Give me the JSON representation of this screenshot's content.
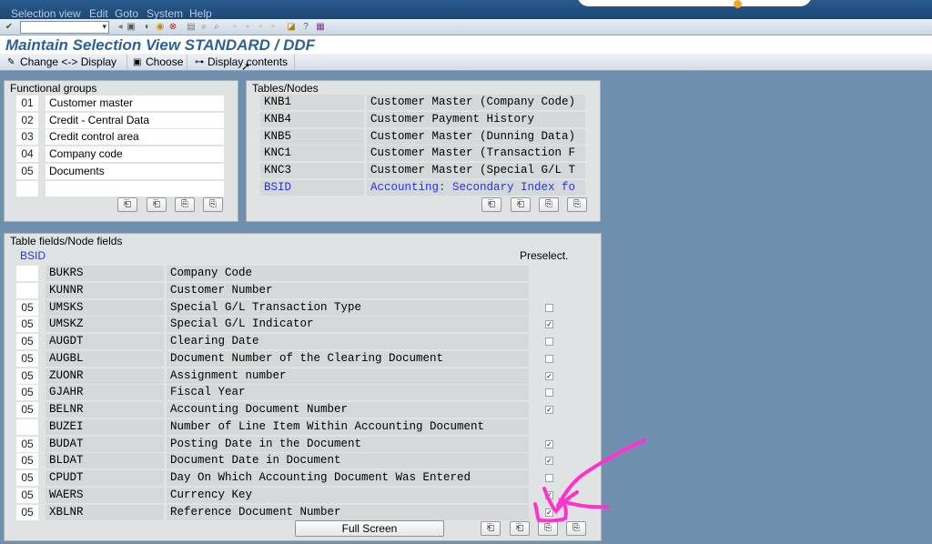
{
  "menu": [
    "Selection view",
    "Edit",
    "Goto",
    "System",
    "Help"
  ],
  "title": "Maintain Selection View STANDARD / DDF",
  "app_toolbar": [
    "Change <-> Display",
    "Choose",
    "Display contents"
  ],
  "functional_groups": {
    "tab": "Functional groups",
    "rows": [
      {
        "num": "01",
        "label": "Customer master"
      },
      {
        "num": "02",
        "label": "Credit - Central Data"
      },
      {
        "num": "03",
        "label": "Credit control area"
      },
      {
        "num": "04",
        "label": "Company code"
      },
      {
        "num": "05",
        "label": "Documents"
      },
      {
        "num": "",
        "label": ""
      }
    ]
  },
  "tables_nodes": {
    "tab": "Tables/Nodes",
    "rows": [
      {
        "name": "KNB1",
        "desc": "Customer Master (Company Code)"
      },
      {
        "name": "KNB4",
        "desc": "Customer Payment History"
      },
      {
        "name": "KNB5",
        "desc": "Customer Master (Dunning Data)"
      },
      {
        "name": "KNC1",
        "desc": "Customer Master (Transaction F"
      },
      {
        "name": "KNC3",
        "desc": "Customer Master (Special G/L T"
      },
      {
        "name": "BSID",
        "desc": "Accounting: Secondary Index fo"
      }
    ]
  },
  "fields": {
    "tab": "Table fields/Node fields",
    "table": "BSID",
    "preselect_header": "Preselect.",
    "rows": [
      {
        "num": "",
        "field": "BUKRS",
        "desc": "Company Code",
        "checked": null
      },
      {
        "num": "",
        "field": "KUNNR",
        "desc": "Customer Number",
        "checked": null
      },
      {
        "num": "05",
        "field": "UMSKS",
        "desc": "Special G/L Transaction Type",
        "checked": false
      },
      {
        "num": "05",
        "field": "UMSKZ",
        "desc": "Special G/L Indicator",
        "checked": true
      },
      {
        "num": "05",
        "field": "AUGDT",
        "desc": "Clearing Date",
        "checked": false
      },
      {
        "num": "05",
        "field": "AUGBL",
        "desc": "Document Number of the Clearing Document",
        "checked": false
      },
      {
        "num": "05",
        "field": "ZUONR",
        "desc": "Assignment number",
        "checked": true
      },
      {
        "num": "05",
        "field": "GJAHR",
        "desc": "Fiscal Year",
        "checked": false
      },
      {
        "num": "05",
        "field": "BELNR",
        "desc": "Accounting Document Number",
        "checked": true
      },
      {
        "num": "",
        "field": "BUZEI",
        "desc": "Number of Line Item Within Accounting Document",
        "checked": null
      },
      {
        "num": "05",
        "field": "BUDAT",
        "desc": "Posting Date in the Document",
        "checked": true
      },
      {
        "num": "05",
        "field": "BLDAT",
        "desc": "Document Date in Document",
        "checked": true
      },
      {
        "num": "05",
        "field": "CPUDT",
        "desc": "Day On Which Accounting Document Was Entered",
        "checked": false
      },
      {
        "num": "05",
        "field": "WAERS",
        "desc": "Currency Key",
        "checked": true
      },
      {
        "num": "05",
        "field": "XBLNR",
        "desc": "Reference Document Number",
        "checked": true
      }
    ]
  },
  "full_screen_label": "Full Screen",
  "colors": {
    "accent": "#2d5f9c",
    "annotation": "#ff33cc"
  }
}
